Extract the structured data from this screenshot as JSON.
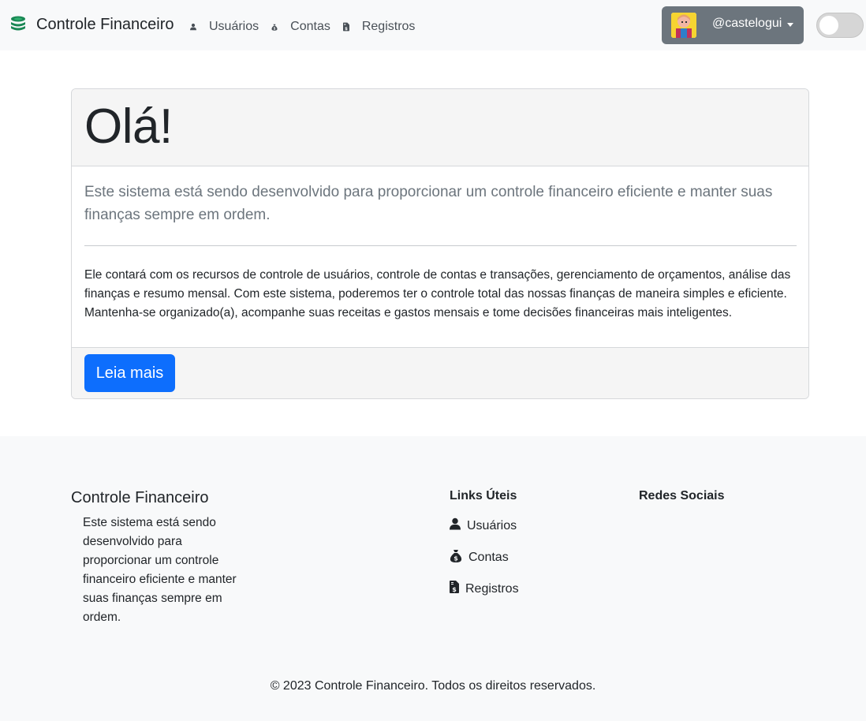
{
  "navbar": {
    "brand": "Controle Financeiro",
    "brand_icon": "coins-stack-icon",
    "links": [
      {
        "label": "Usuários",
        "icon": "user-icon"
      },
      {
        "label": "Contas",
        "icon": "money-bag-icon"
      },
      {
        "label": "Registros",
        "icon": "file-invoice-dollar-icon"
      }
    ],
    "user": {
      "username": "@castelogui",
      "avatar": "avatar-icon"
    },
    "theme_toggle": {
      "checked": false
    }
  },
  "card": {
    "title": "Olá!",
    "lead": "Este sistema está sendo desenvolvido para proporcionar um controle financeiro eficiente e manter suas finanças sempre em ordem.",
    "body": "Ele contará com os recursos de controle de usuários, controle de contas e transações, gerenciamento de orçamentos, análise das finanças e resumo mensal. Com este sistema, poderemos ter o controle total das nossas finanças de maneira simples e eficiente. Mantenha-se organizado(a), acompanhe suas receitas e gastos mensais e tome decisões financeiras mais inteligentes.",
    "button": "Leia mais"
  },
  "footer": {
    "brand": "Controle Financeiro",
    "description": "Este sistema está sendo desenvolvido para proporcionar um controle financeiro eficiente e manter suas finanças sempre em ordem.",
    "links_title": "Links Úteis",
    "links": [
      {
        "label": "Usuários",
        "icon": "user-icon"
      },
      {
        "label": "Contas",
        "icon": "money-bag-icon"
      },
      {
        "label": "Registros",
        "icon": "file-invoice-dollar-icon"
      }
    ],
    "social_title": "Redes Sociais",
    "copyright": "© 2023 Controle Financeiro. Todos os direitos reservados."
  },
  "colors": {
    "primary": "#0d6efd",
    "brand_icon": "#198754",
    "user_button": "#6c757d"
  }
}
